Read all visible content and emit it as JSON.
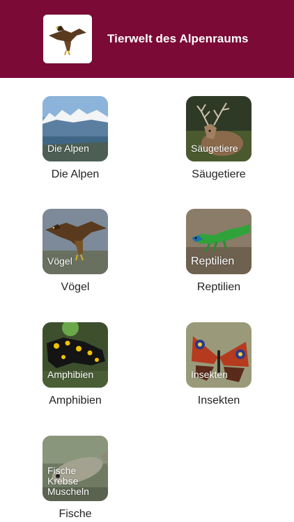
{
  "header": {
    "title": "Tierwelt des Alpenraums",
    "logo_icon": "eagle-icon",
    "background": "#7b0a36"
  },
  "categories": [
    {
      "tile_label": "Die Alpen",
      "caption": "Die Alpen",
      "icon": "mountain-landscape-icon"
    },
    {
      "tile_label": "Säugetiere",
      "caption": "Säugetiere",
      "icon": "deer-icon"
    },
    {
      "tile_label": "Vögel",
      "caption": "Vögel",
      "icon": "eagle-icon"
    },
    {
      "tile_label": "Reptilien",
      "caption": "Reptilien",
      "icon": "lizard-icon"
    },
    {
      "tile_label": "Amphibien",
      "caption": "Amphibien",
      "icon": "salamander-icon"
    },
    {
      "tile_label": "Insekten",
      "caption": "Insekten",
      "icon": "butterfly-icon"
    },
    {
      "tile_label": "Fische\nKrebse\nMuscheln",
      "caption": "Fische",
      "icon": "fish-icon"
    }
  ]
}
